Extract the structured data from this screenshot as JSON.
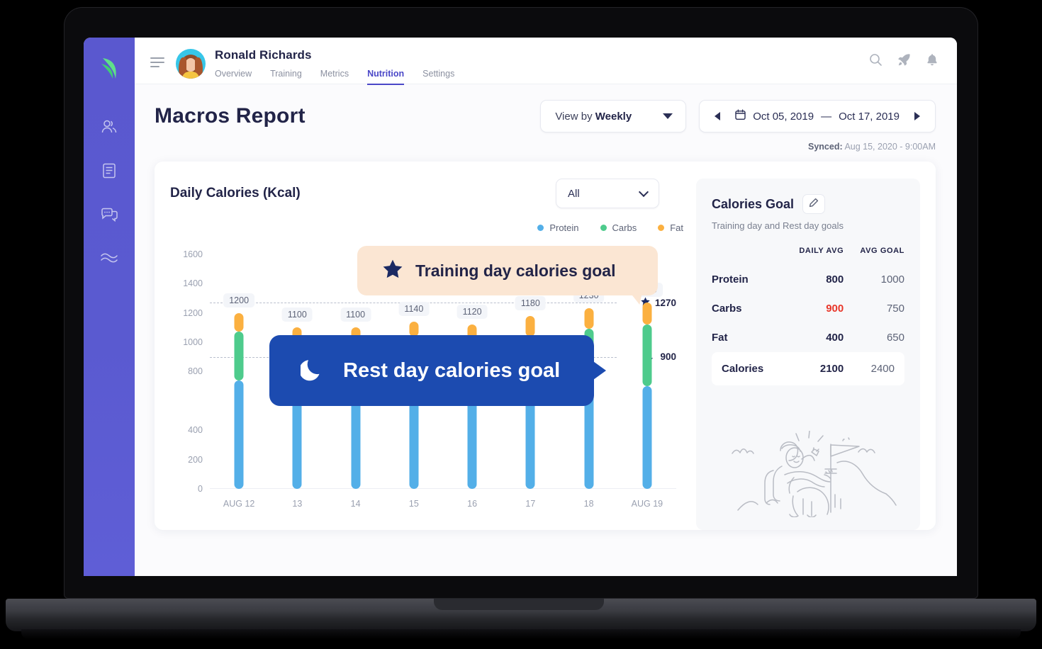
{
  "sidebar": {
    "logo_icon": "leaf-logo-icon",
    "items": [
      {
        "icon": "users-icon",
        "name": "clients"
      },
      {
        "icon": "document-icon",
        "name": "programs"
      },
      {
        "icon": "chat-icon",
        "name": "messages"
      },
      {
        "icon": "waves-icon",
        "name": "activity"
      }
    ]
  },
  "header": {
    "menu_icon": "hamburger-icon",
    "user_name": "Ronald Richards",
    "tabs": [
      {
        "label": "Overview",
        "active": false
      },
      {
        "label": "Training",
        "active": false
      },
      {
        "label": "Metrics",
        "active": false
      },
      {
        "label": "Nutrition",
        "active": true
      },
      {
        "label": "Settings",
        "active": false
      }
    ],
    "icons": [
      "search-icon",
      "rocket-icon",
      "bell-icon"
    ]
  },
  "toolbar": {
    "page_title": "Macros Report",
    "view_by_prefix": "View by ",
    "view_by_value": "Weekly",
    "date_start": "Oct 05, 2019",
    "date_separator": "—",
    "date_end": "Oct 17, 2019",
    "synced_label": "Synced:",
    "synced_value": "Aug 15, 2020 - 9:00AM"
  },
  "chart_card": {
    "title": "Daily Calories (Kcal)",
    "filter_value": "All",
    "callout_training": "Training day calories goal",
    "callout_rest": "Rest day calories goal",
    "star_icon": "star-icon",
    "moon_icon": "moon-icon"
  },
  "chart_data": {
    "type": "bar",
    "title": "Daily Calories (Kcal)",
    "xlabel": "",
    "ylabel": "",
    "ylim": [
      0,
      1700
    ],
    "yticks": [
      0,
      200,
      400,
      800,
      1000,
      1200,
      1400,
      1600
    ],
    "grid": false,
    "stacked": true,
    "legend_position": "top-right",
    "categories": [
      "AUG 12",
      "13",
      "14",
      "15",
      "16",
      "17",
      "18",
      "AUG 19"
    ],
    "totals": [
      1200,
      1100,
      1100,
      1140,
      1120,
      1180,
      1230,
      1270
    ],
    "series": [
      {
        "name": "Protein",
        "color": "#53afe8",
        "values": [
          740,
          690,
          700,
          700,
          640,
          660,
          690,
          700
        ]
      },
      {
        "name": "Carbs",
        "color": "#4ecb8c",
        "values": [
          330,
          310,
          310,
          340,
          360,
          380,
          400,
          420
        ]
      },
      {
        "name": "Fat",
        "color": "#fbb040",
        "values": [
          130,
          100,
          90,
          100,
          120,
          140,
          140,
          150
        ]
      }
    ],
    "goal_lines": [
      {
        "label": "1270",
        "value": 1270,
        "icon": "star-icon",
        "type": "training"
      },
      {
        "label": "900",
        "value": 900,
        "icon": "moon-icon",
        "type": "rest"
      }
    ]
  },
  "goal_panel": {
    "title": "Calories Goal",
    "edit_icon": "pencil-icon",
    "subtitle": "Training day and Rest day goals",
    "columns": [
      "",
      "DAILY AVG",
      "AVG GOAL"
    ],
    "rows": [
      {
        "label": "Protein",
        "daily_avg": "800",
        "avg_goal": "1000",
        "over": false
      },
      {
        "label": "Carbs",
        "daily_avg": "900",
        "avg_goal": "750",
        "over": true
      },
      {
        "label": "Fat",
        "daily_avg": "400",
        "avg_goal": "650",
        "over": false
      }
    ],
    "total": {
      "label": "Calories",
      "daily_avg": "2100",
      "avg_goal": "2400"
    },
    "illustration": "climber-with-flag-illustration"
  },
  "colors": {
    "accent": "#4a47c7",
    "sidebar": "#5a58cf",
    "protein": "#53afe8",
    "carbs": "#4ecb8c",
    "fat": "#fbb040",
    "over_goal": "#e8372a",
    "callout_training_bg": "#fbe6d3",
    "callout_rest_bg": "#1c4bb0"
  }
}
